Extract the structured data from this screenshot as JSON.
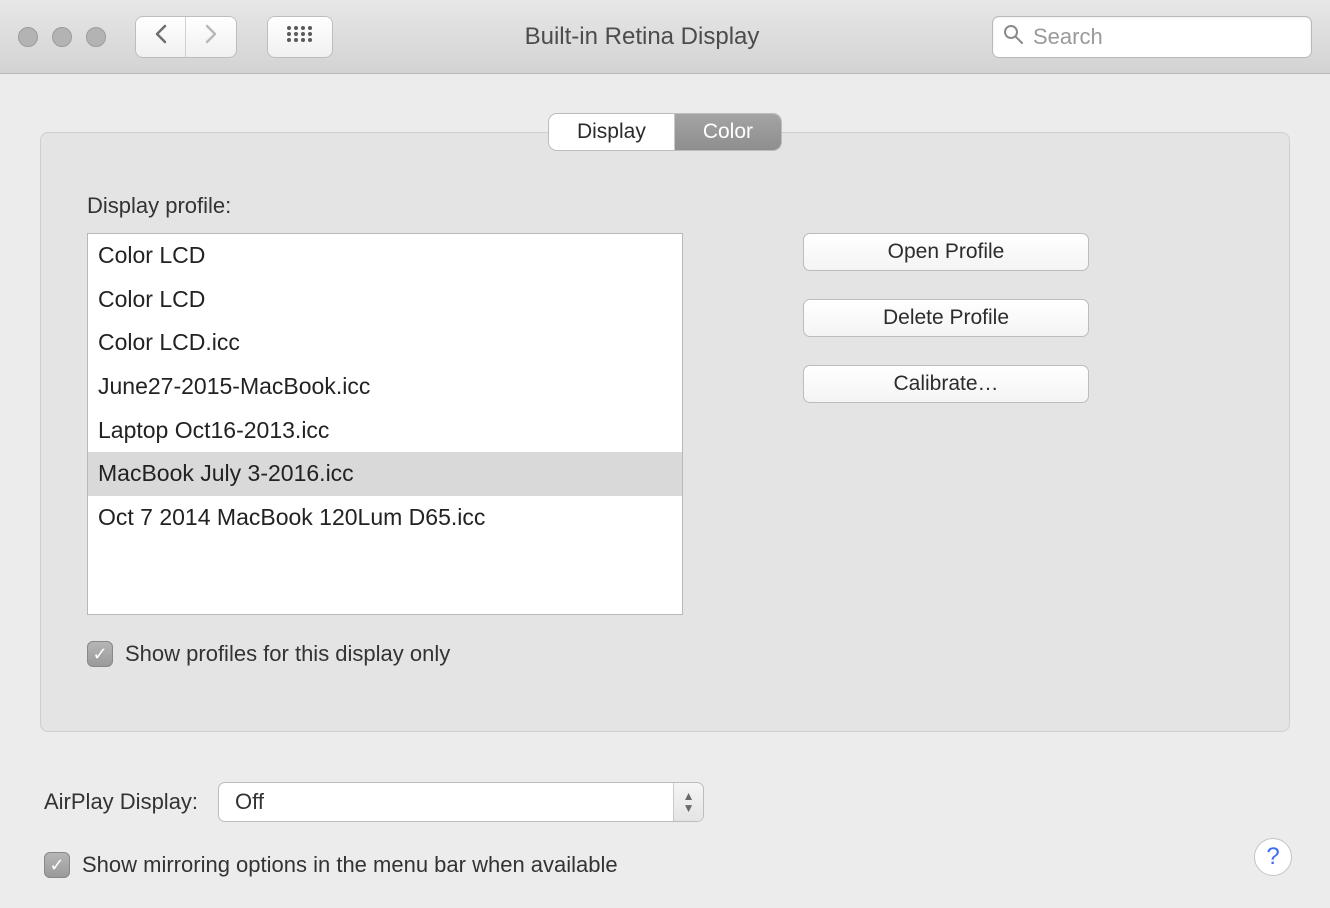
{
  "toolbar": {
    "window_title": "Built-in Retina Display",
    "search_placeholder": "Search"
  },
  "tabs": {
    "display": "Display",
    "color": "Color",
    "active": "Color"
  },
  "profile_section": {
    "label": "Display profile:",
    "items": [
      "Color LCD",
      "Color LCD",
      "Color LCD.icc",
      "June27-2015-MacBook.icc",
      "Laptop Oct16-2013.icc",
      "MacBook July 3-2016.icc",
      "Oct 7 2014 MacBook 120Lum D65.icc"
    ],
    "selected_index": 5,
    "show_only_label": "Show profiles for this display only",
    "show_only_checked": true
  },
  "actions": {
    "open": "Open Profile",
    "delete": "Delete Profile",
    "calibrate": "Calibrate…"
  },
  "footer": {
    "airplay_label": "AirPlay Display:",
    "airplay_value": "Off",
    "mirroring_label": "Show mirroring options in the menu bar when available",
    "mirroring_checked": true,
    "help": "?"
  }
}
